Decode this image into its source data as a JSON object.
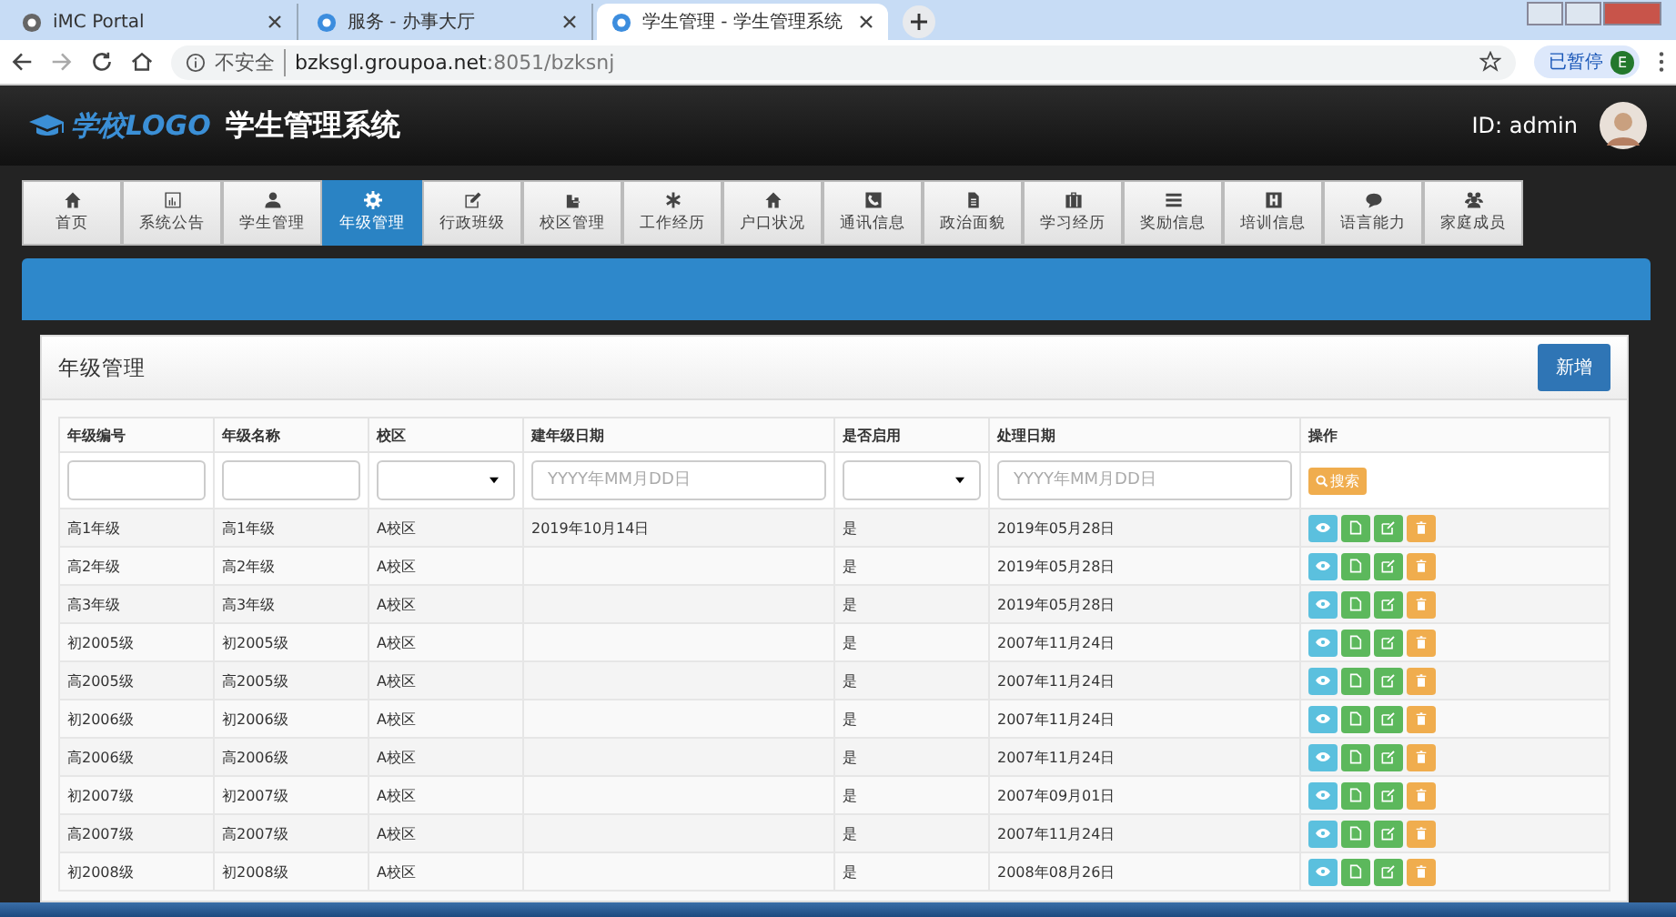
{
  "browser": {
    "tabs": [
      {
        "label": "iMC Portal",
        "selected": false
      },
      {
        "label": "服务 - 办事大厅",
        "selected": false
      },
      {
        "label": "学生管理 - 学生管理系统",
        "selected": true
      }
    ],
    "security": "不安全",
    "url_host": "bzksgl.groupoa.net",
    "url_path": ":8051/bzksnj",
    "profile_label": "已暂停",
    "profile_initial": "E"
  },
  "header": {
    "logo": "学校LOGO",
    "title": "学生管理系统",
    "user": "ID: admin"
  },
  "nav": [
    {
      "label": "首页",
      "selected": false
    },
    {
      "label": "系统公告",
      "selected": false
    },
    {
      "label": "学生管理",
      "selected": false
    },
    {
      "label": "年级管理",
      "selected": true
    },
    {
      "label": "行政班级",
      "selected": false
    },
    {
      "label": "校区管理",
      "selected": false
    },
    {
      "label": "工作经历",
      "selected": false
    },
    {
      "label": "户口状况",
      "selected": false
    },
    {
      "label": "通讯信息",
      "selected": false
    },
    {
      "label": "政治面貌",
      "selected": false
    },
    {
      "label": "学习经历",
      "selected": false
    },
    {
      "label": "奖励信息",
      "selected": false
    },
    {
      "label": "培训信息",
      "selected": false
    },
    {
      "label": "语言能力",
      "selected": false
    },
    {
      "label": "家庭成员",
      "selected": false
    }
  ],
  "panel": {
    "title": "年级管理",
    "add_button": "新增"
  },
  "table": {
    "columns": [
      "年级编号",
      "年级名称",
      "校区",
      "建年级日期",
      "是否启用",
      "处理日期",
      "操作"
    ],
    "filters": [
      {
        "kind": "text"
      },
      {
        "kind": "text"
      },
      {
        "kind": "select"
      },
      {
        "kind": "date",
        "placeholder": "YYYY年MM月DD日"
      },
      {
        "kind": "select"
      },
      {
        "kind": "date",
        "placeholder": "YYYY年MM月DD日"
      },
      {
        "kind": "search",
        "label": "搜索"
      }
    ],
    "rows": [
      [
        "高1年级",
        "高1年级",
        "A校区",
        "2019年10月14日",
        "是",
        "2019年05月28日"
      ],
      [
        "高2年级",
        "高2年级",
        "A校区",
        "",
        "是",
        "2019年05月28日"
      ],
      [
        "高3年级",
        "高3年级",
        "A校区",
        "",
        "是",
        "2019年05月28日"
      ],
      [
        "初2005级",
        "初2005级",
        "A校区",
        "",
        "是",
        "2007年11月24日"
      ],
      [
        "高2005级",
        "高2005级",
        "A校区",
        "",
        "是",
        "2007年11月24日"
      ],
      [
        "初2006级",
        "初2006级",
        "A校区",
        "",
        "是",
        "2007年11月24日"
      ],
      [
        "高2006级",
        "高2006级",
        "A校区",
        "",
        "是",
        "2007年11月24日"
      ],
      [
        "初2007级",
        "初2007级",
        "A校区",
        "",
        "是",
        "2007年09月01日"
      ],
      [
        "高2007级",
        "高2007级",
        "A校区",
        "",
        "是",
        "2007年11月24日"
      ],
      [
        "初2008级",
        "初2008级",
        "A校区",
        "",
        "是",
        "2008年08月26日"
      ]
    ]
  }
}
